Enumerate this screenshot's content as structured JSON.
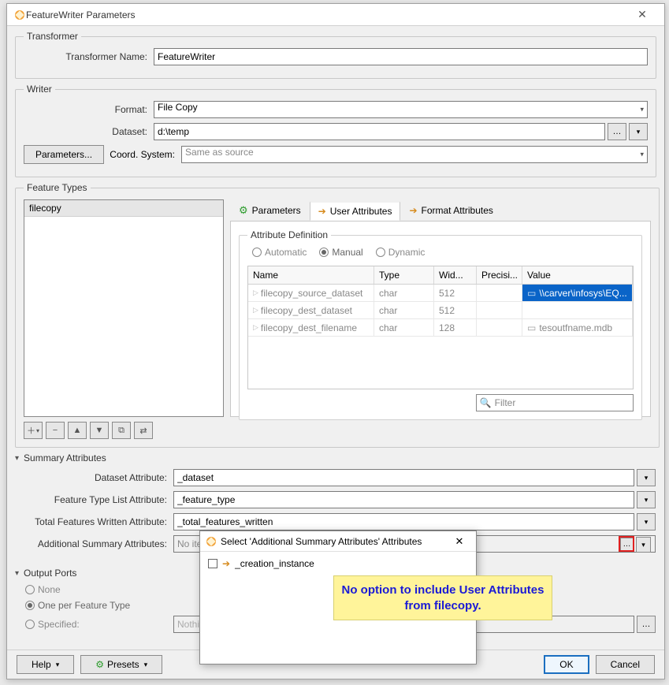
{
  "window": {
    "title": "FeatureWriter Parameters"
  },
  "transformer": {
    "legend": "Transformer",
    "name_label": "Transformer Name:",
    "name_value": "FeatureWriter"
  },
  "writer": {
    "legend": "Writer",
    "format_label": "Format:",
    "format_value": "File Copy",
    "dataset_label": "Dataset:",
    "dataset_value": "d:\\temp",
    "params_btn": "Parameters...",
    "coord_label": "Coord. System:",
    "coord_value": "Same as source"
  },
  "feature_types": {
    "legend": "Feature Types",
    "list_item": "filecopy",
    "tabs": {
      "parameters": "Parameters",
      "user_attributes": "User Attributes",
      "format_attributes": "Format Attributes"
    },
    "attr_def_legend": "Attribute Definition",
    "radios": {
      "auto": "Automatic",
      "manual": "Manual",
      "dynamic": "Dynamic"
    },
    "table": {
      "headers": {
        "name": "Name",
        "type": "Type",
        "width": "Wid...",
        "precision": "Precisi...",
        "value": "Value"
      },
      "rows": [
        {
          "name": "filecopy_source_dataset",
          "type": "char",
          "width": "512",
          "precision": "",
          "value": "\\\\carver\\infosys\\EQ...",
          "hl": true
        },
        {
          "name": "filecopy_dest_dataset",
          "type": "char",
          "width": "512",
          "precision": "",
          "value": "",
          "hl": false
        },
        {
          "name": "filecopy_dest_filename",
          "type": "char",
          "width": "128",
          "precision": "",
          "value": "tesoutfname.mdb",
          "hl": false
        }
      ]
    },
    "filter_placeholder": "Filter"
  },
  "summary": {
    "head": "Summary Attributes",
    "dataset_attr_label": "Dataset Attribute:",
    "dataset_attr_value": "_dataset",
    "ft_list_label": "Feature Type List Attribute:",
    "ft_list_value": "_feature_type",
    "total_label": "Total Features Written Attribute:",
    "total_value": "_total_features_written",
    "addl_label": "Additional Summary Attributes:",
    "addl_value": "No items s"
  },
  "output_ports": {
    "head": "Output Ports",
    "none": "None",
    "one_per_ft": "One per Feature Type",
    "specified": "Specified:",
    "specified_value": "Nothing t"
  },
  "footer": {
    "help": "Help",
    "presets": "Presets",
    "ok": "OK",
    "cancel": "Cancel"
  },
  "popup": {
    "title": "Select 'Additional Summary Attributes' Attributes",
    "item": "_creation_instance"
  },
  "annotation": "No option to include User Attributes from filecopy."
}
